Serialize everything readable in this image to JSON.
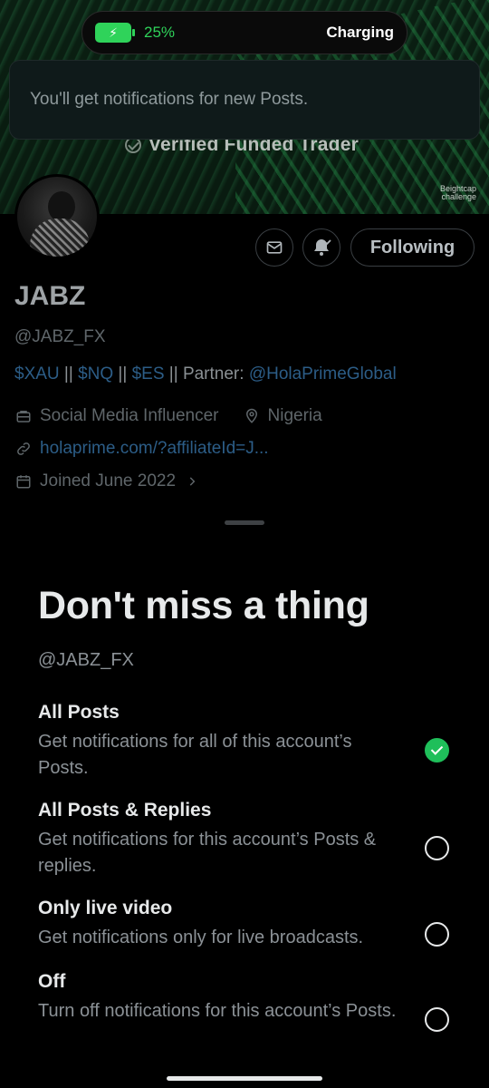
{
  "status_bar": {
    "battery_percent": "25%",
    "charging_label": "Charging",
    "battery_color": "#2fd35a"
  },
  "toast": {
    "message": "You'll get notifications for new Posts."
  },
  "banner": {
    "title": "Verified Funded Trader",
    "brand_line1": "Beightcap",
    "brand_line2": "challenge"
  },
  "profile": {
    "name": "JABZ",
    "handle": "@JABZ_FX",
    "bio": {
      "tickers": "$XAU || $NQ || $ES || ",
      "tag_1": "$XAU",
      "sep_1": " || ",
      "tag_2": "$NQ",
      "sep_2": " || ",
      "tag_3": "$ES",
      "sep_3": " || Partner: ",
      "mention": "@HolaPrimeGlobal"
    },
    "category": "Social Media Influencer",
    "location": "Nigeria",
    "website": "holaprime.com/?affiliateId=J...",
    "joined": "Joined June 2022",
    "following_label": "Following",
    "icons": {
      "message": "envelope-icon",
      "notifications": "bell-check-icon",
      "category": "briefcase-icon",
      "location": "location-pin-icon",
      "website": "link-icon",
      "joined": "calendar-icon"
    }
  },
  "sheet": {
    "title": "Don't miss a thing",
    "handle": "@JABZ_FX",
    "options": [
      {
        "title": "All Posts",
        "description": "Get notifications for all of this account’s Posts.",
        "selected": true
      },
      {
        "title": "All Posts & Replies",
        "description": "Get notifications for this account’s Posts & replies.",
        "selected": false
      },
      {
        "title": "Only live video",
        "description": "Get notifications only for live broadcasts.",
        "selected": false
      },
      {
        "title": "Off",
        "description": "Turn off notifications for this account’s Posts.",
        "selected": false
      }
    ],
    "selected_color": "#1fbf5a"
  }
}
